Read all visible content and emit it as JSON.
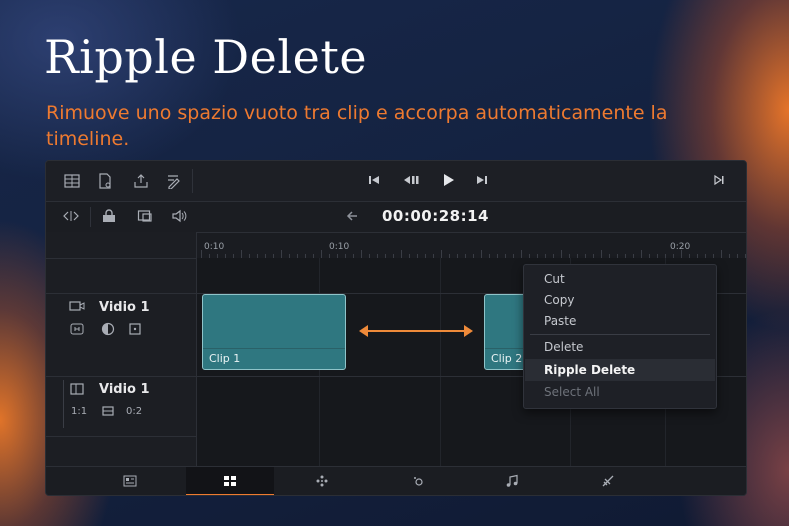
{
  "heading": {
    "title": "Ripple Delete",
    "subtitle": "Rimuove uno spazio vuoto tra clip e accorpa automaticamente la timeline."
  },
  "colors": {
    "accent": "#ee7a30",
    "clip_fill": "#2f7780",
    "clip_border": "#8fc4c9",
    "panel": "#1a1c21"
  },
  "toolbar": {
    "left_icons": [
      "grid-icon",
      "document-icon",
      "export-icon",
      "edit-tool-icon"
    ],
    "transport": [
      "skip-back-icon",
      "step-back-icon",
      "play-icon",
      "skip-forward-icon"
    ],
    "right_icon": "go-to-end-icon"
  },
  "subbar": {
    "icons": [
      "trim-icon",
      "lock-icon",
      "snapshot-icon",
      "audio-icon",
      "back-arrow-icon"
    ],
    "timecode": "00:00:28:14"
  },
  "ruler": {
    "labels": [
      "0:10",
      "0:10",
      "0:20"
    ]
  },
  "tracks": [
    {
      "name": "Vidio 1",
      "icons": [
        "camera-icon",
        "link-icon",
        "contrast-icon",
        "box-icon"
      ]
    },
    {
      "name": "Vidio 1",
      "ratio": "1:1",
      "value": "0:2",
      "icons": [
        "panel-icon",
        "stack-icon"
      ]
    }
  ],
  "clips": [
    {
      "label": "Clip 1"
    },
    {
      "label": "Clip 2"
    }
  ],
  "gap_indicator": "double-arrow",
  "context_menu": {
    "items": [
      {
        "label": "Cut",
        "state": "normal"
      },
      {
        "label": "Copy",
        "state": "normal"
      },
      {
        "label": "Paste",
        "state": "normal"
      },
      {
        "label": "Delete",
        "state": "normal"
      },
      {
        "label": "Ripple Delete",
        "state": "highlighted"
      },
      {
        "label": "Select All",
        "state": "disabled"
      }
    ]
  },
  "bottom_tabs": [
    {
      "icon": "media-icon",
      "active": false
    },
    {
      "icon": "edit-page-icon",
      "active": true
    },
    {
      "icon": "fusion-icon",
      "active": false
    },
    {
      "icon": "color-icon",
      "active": false
    },
    {
      "icon": "music-icon",
      "active": false
    },
    {
      "icon": "deliver-icon",
      "active": false
    }
  ]
}
